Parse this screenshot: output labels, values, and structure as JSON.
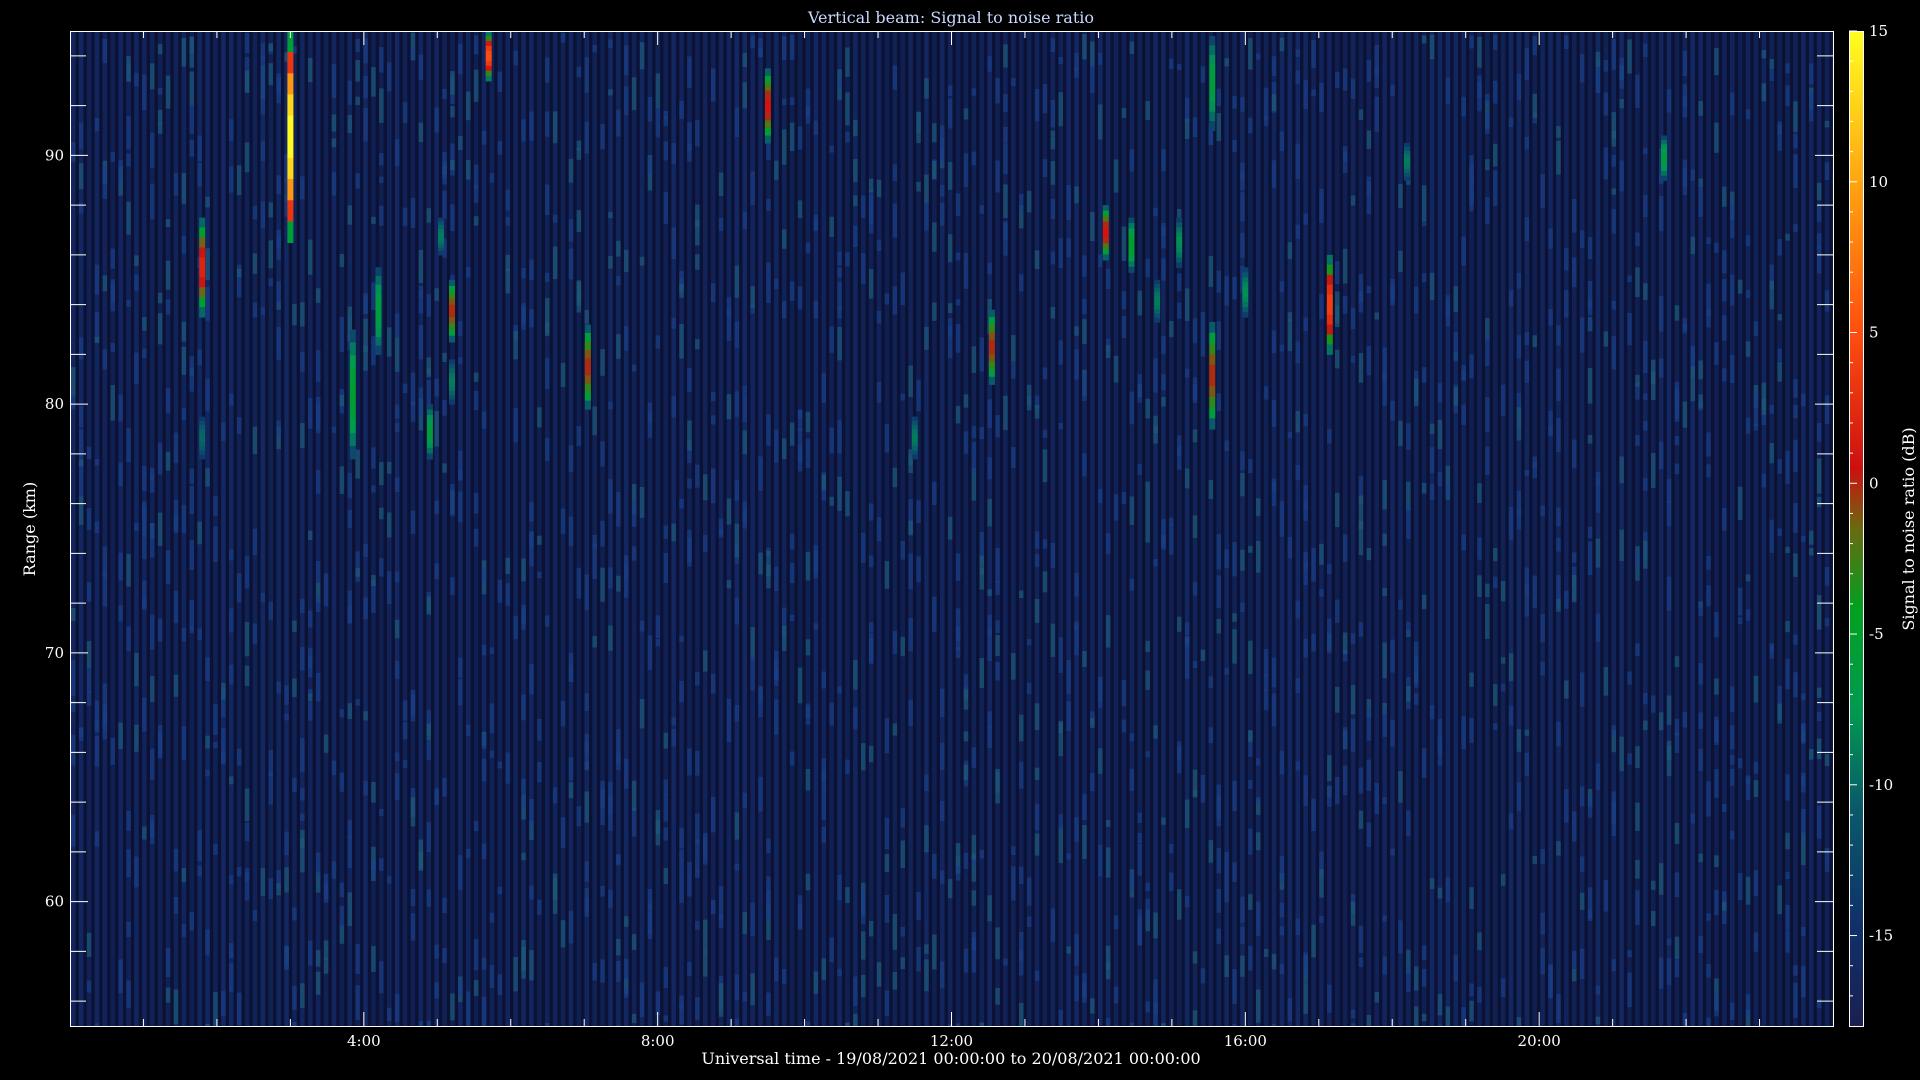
{
  "chart_data": {
    "type": "heatmap",
    "title": "Vertical beam: Signal to noise ratio",
    "xlabel": "Universal time - 19/08/2021 00:00:00 to 20/08/2021 00:00:00",
    "ylabel": "Range (km)",
    "xlim": [
      0,
      24
    ],
    "ylim": [
      55,
      95
    ],
    "x_ticks": [
      {
        "value": 4,
        "label": "4:00"
      },
      {
        "value": 8,
        "label": "8:00"
      },
      {
        "value": 12,
        "label": "12:00"
      },
      {
        "value": 16,
        "label": "16:00"
      },
      {
        "value": 20,
        "label": "20:00"
      }
    ],
    "y_ticks": [
      {
        "value": 60,
        "label": "60"
      },
      {
        "value": 70,
        "label": "70"
      },
      {
        "value": 80,
        "label": "80"
      },
      {
        "value": 90,
        "label": "90"
      }
    ],
    "colorbar": {
      "label": "Signal to noise ratio (dB)",
      "min": -18,
      "max": 15,
      "ticks": [
        {
          "value": 15,
          "label": "15"
        },
        {
          "value": 10,
          "label": "10"
        },
        {
          "value": 5,
          "label": "5"
        },
        {
          "value": 0,
          "label": "0"
        },
        {
          "value": -5,
          "label": "-5"
        },
        {
          "value": -10,
          "label": "-10"
        },
        {
          "value": -15,
          "label": "-15"
        }
      ],
      "colors": [
        "#1a2050",
        "#10306a",
        "#0a5a6a",
        "#009a50",
        "#00a020",
        "#6a6a10",
        "#cc1010",
        "#ff5010",
        "#ffa010",
        "#ffff20"
      ]
    },
    "background_level_db": -16,
    "echoes": [
      {
        "time": 1.8,
        "range_min": 83.5,
        "range_max": 87.5,
        "peak_db": 2
      },
      {
        "time": 1.8,
        "range_min": 77.8,
        "range_max": 79.5,
        "peak_db": -10
      },
      {
        "time": 3.0,
        "range_min": 86.5,
        "range_max": 95.0,
        "peak_db": 15
      },
      {
        "time": 3.85,
        "range_min": 77.8,
        "range_max": 83.0,
        "peak_db": -5
      },
      {
        "time": 4.2,
        "range_min": 82.0,
        "range_max": 85.5,
        "peak_db": -6
      },
      {
        "time": 4.9,
        "range_min": 77.8,
        "range_max": 80.0,
        "peak_db": -6
      },
      {
        "time": 5.05,
        "range_min": 86.0,
        "range_max": 87.5,
        "peak_db": -9
      },
      {
        "time": 5.2,
        "range_min": 82.5,
        "range_max": 85.0,
        "peak_db": 0
      },
      {
        "time": 5.2,
        "range_min": 80.0,
        "range_max": 81.8,
        "peak_db": -9
      },
      {
        "time": 5.7,
        "range_min": 93.0,
        "range_max": 95.0,
        "peak_db": 5
      },
      {
        "time": 7.05,
        "range_min": 79.8,
        "range_max": 83.2,
        "peak_db": 0
      },
      {
        "time": 9.5,
        "range_min": 90.5,
        "range_max": 93.5,
        "peak_db": 1
      },
      {
        "time": 11.5,
        "range_min": 77.8,
        "range_max": 79.5,
        "peak_db": -9
      },
      {
        "time": 12.55,
        "range_min": 80.8,
        "range_max": 83.8,
        "peak_db": 0
      },
      {
        "time": 14.1,
        "range_min": 85.8,
        "range_max": 88.0,
        "peak_db": 1
      },
      {
        "time": 14.45,
        "range_min": 85.3,
        "range_max": 87.5,
        "peak_db": -5
      },
      {
        "time": 14.8,
        "range_min": 83.3,
        "range_max": 85.0,
        "peak_db": -9
      },
      {
        "time": 15.1,
        "range_min": 85.5,
        "range_max": 87.5,
        "peak_db": -8
      },
      {
        "time": 15.55,
        "range_min": 79.0,
        "range_max": 83.3,
        "peak_db": 0
      },
      {
        "time": 15.55,
        "range_min": 91.0,
        "range_max": 94.8,
        "peak_db": -6
      },
      {
        "time": 16.0,
        "range_min": 83.5,
        "range_max": 85.5,
        "peak_db": -8
      },
      {
        "time": 17.15,
        "range_min": 82.0,
        "range_max": 86.0,
        "peak_db": 4
      },
      {
        "time": 18.2,
        "range_min": 89.0,
        "range_max": 90.5,
        "peak_db": -9
      },
      {
        "time": 21.7,
        "range_min": 89.0,
        "range_max": 90.8,
        "peak_db": -6
      }
    ]
  }
}
